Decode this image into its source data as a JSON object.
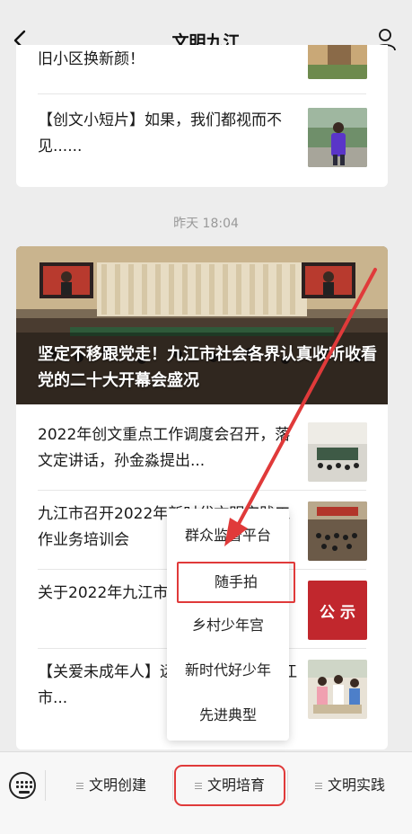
{
  "header": {
    "title": "文明九江",
    "back_icon": "chevron-left-icon",
    "user_icon": "user-icon"
  },
  "card1": {
    "items": [
      {
        "title": "旧小区换新颜！"
      },
      {
        "title": "【创文小短片】如果，我们都视而不见......"
      }
    ]
  },
  "timestamp": "昨天 18:04",
  "card2": {
    "hero_caption": "坚定不移跟党走！九江市社会各界认真收听收看党的二十大开幕会盛况",
    "items": [
      {
        "title": "2022年创文重点工作调度会召开，落文定讲话，孙金淼提出..."
      },
      {
        "title": "九江市召开2022年新时代文明实践工作业务培训会"
      },
      {
        "title": "关于2022年九江市...推荐名单公示",
        "thumb_text": "公 示"
      },
      {
        "title": "【关爱未成年人】远离网络沉迷！九江市..."
      }
    ]
  },
  "popup_menu": {
    "items": [
      {
        "label": "群众监督平台"
      },
      {
        "label": "随手拍",
        "highlighted": true
      },
      {
        "label": "乡村少年宫"
      },
      {
        "label": "新时代好少年"
      },
      {
        "label": "先进典型"
      }
    ]
  },
  "bottom_bar": {
    "tabs": [
      {
        "label": "文明创建"
      },
      {
        "label": "文明培育",
        "active": true
      },
      {
        "label": "文明实践"
      }
    ]
  },
  "colors": {
    "annotation_red": "#e03a3a",
    "background": "#ededed"
  }
}
